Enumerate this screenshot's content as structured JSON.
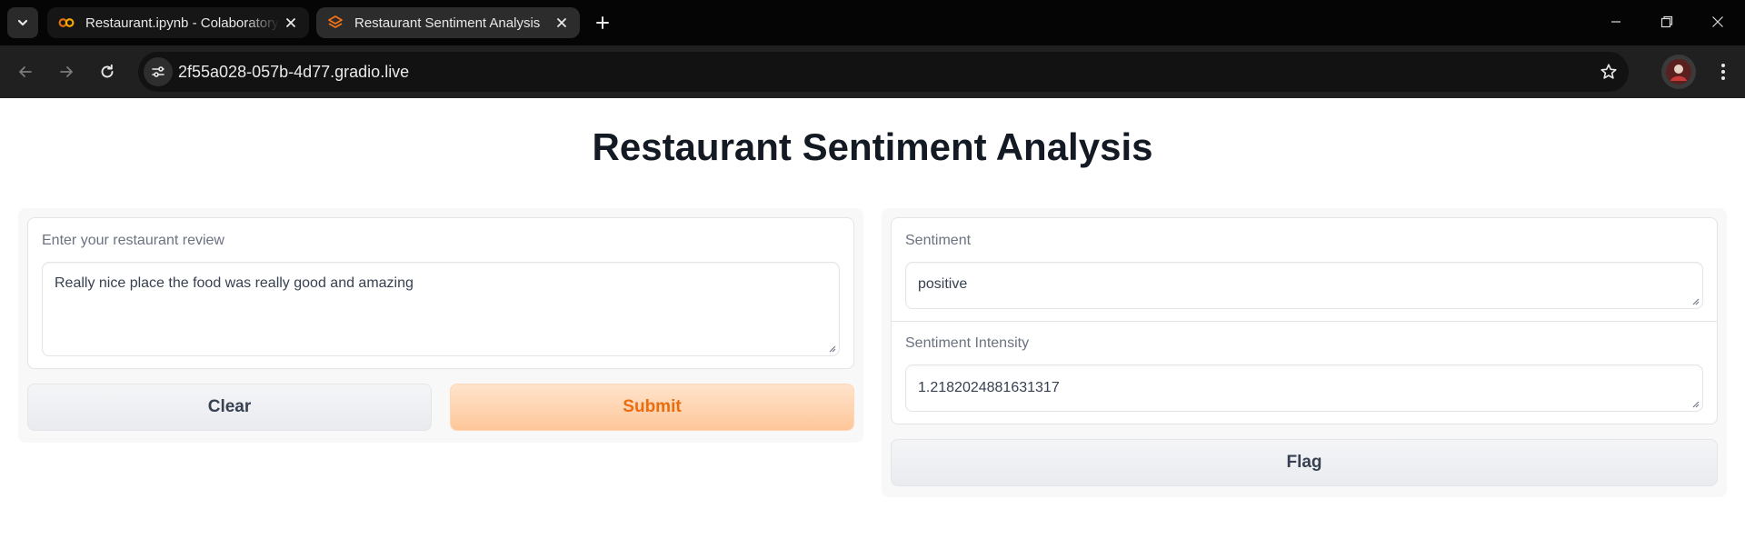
{
  "browser": {
    "tabs": [
      {
        "title": "Restaurant.ipynb - Colaboratory",
        "favicon": "colab-icon",
        "active": false
      },
      {
        "title": "Restaurant Sentiment Analysis",
        "favicon": "gradio-icon",
        "active": true
      }
    ],
    "url": "2f55a028-057b-4d77.gradio.live"
  },
  "app": {
    "title": "Restaurant Sentiment Analysis"
  },
  "inputs": {
    "review_label": "Enter your restaurant review",
    "review_value": "Really nice place the food was really good and amazing"
  },
  "outputs": {
    "sentiment_label": "Sentiment",
    "sentiment_value": "positive",
    "intensity_label": "Sentiment Intensity",
    "intensity_value": "1.2182024881631317"
  },
  "buttons": {
    "clear": "Clear",
    "submit": "Submit",
    "flag": "Flag"
  },
  "colors": {
    "primary_text": "#ea6c0c",
    "primary_bg": "#fec699",
    "chrome_bg": "#050505"
  }
}
